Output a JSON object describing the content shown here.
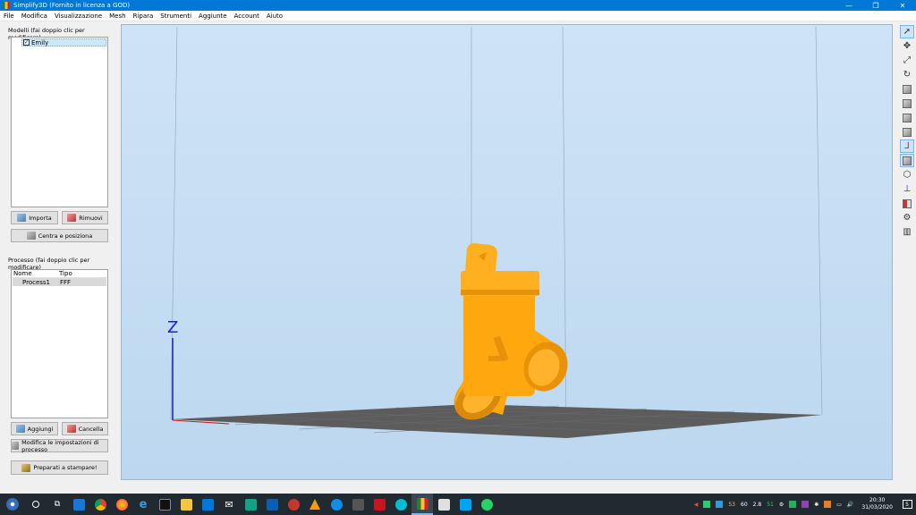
{
  "window": {
    "title": "Simplify3D (Fornito in licenza a GOD)",
    "minimize_label": "—",
    "restore_label": "❐",
    "close_label": "✕"
  },
  "menu": [
    "File",
    "Modifica",
    "Visualizzazione",
    "Mesh",
    "Ripara",
    "Strumenti",
    "Aggiunte",
    "Account",
    "Aiuto"
  ],
  "models_panel": {
    "label": "Modelli (fai doppio clic per modificare)",
    "items": [
      {
        "name": "Emily",
        "checked": true
      }
    ],
    "import_label": "Importa",
    "remove_label": "Rimuovi",
    "center_label": "Centra e posiziona"
  },
  "process_panel": {
    "label": "Processo (fai doppio clic per modificare)",
    "columns": [
      "Nome",
      "Tipo"
    ],
    "rows": [
      {
        "name": "Process1",
        "type": "FFF"
      }
    ],
    "add_label": "Aggiungi",
    "delete_label": "Cancella",
    "edit_label": "Modifica le impostazioni di processo",
    "prepare_label": "Preparati a stampare!"
  },
  "viewport": {
    "axis_label": "Z",
    "model_color": "#ffa70f",
    "bed_color": "#5c5c5c",
    "background_color": "#c8dff4"
  },
  "right_toolbar": [
    "select-arrow-icon",
    "move-icon",
    "scale-icon",
    "rotate-icon",
    "cube-view-1-icon",
    "cube-view-2-icon",
    "cube-view-3-icon",
    "cube-view-4-icon",
    "axes-icon",
    "cube-shaded-icon",
    "cube-wire-icon",
    "z-axis-icon",
    "cross-section-icon",
    "settings-gear-icon",
    "layers-icon"
  ],
  "taskbar": {
    "tray_numbers": [
      "53",
      "60",
      "2.8",
      "51"
    ],
    "time": "20:30",
    "date": "31/03/2020",
    "notification_count": "5"
  },
  "colors": {
    "accent": "#0078d7",
    "taskbar": "#202a30"
  }
}
